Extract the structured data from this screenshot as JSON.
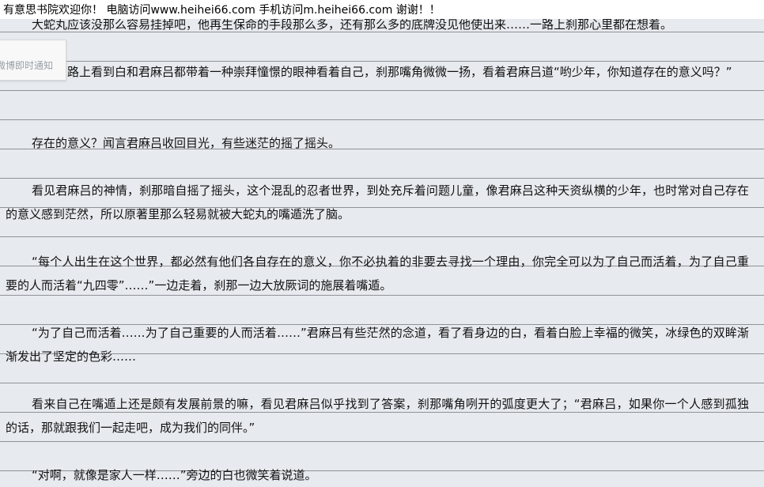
{
  "banner": {
    "text": "有意思书院欢迎你！ 电脑访问www.heihei66.com   手机访问m.heihei66.com  谢谢！！"
  },
  "popup": {
    "text": "微博即时通知"
  },
  "paragraphs": [
    "大蛇丸应该没那么容易挂掉吧，他再生保命的手段那么多，还有那么多的底牌没见他使出来……一路上刹那心里都在想着。",
    "一路的路上看到白和君麻吕都带着一种崇拜憧憬的眼神看着自己，刹那嘴角微微一扬，看着君麻吕道“哟少年，你知道存在的意义吗？”",
    "存在的意义？闻言君麻吕收回目光，有些迷茫的摇了摇头。",
    "看见君麻吕的神情，刹那暗自摇了摇头，这个混乱的忍者世界，到处充斥着问题儿童，像君麻吕这种天资纵横的少年，也时常对自己存在的意义感到茫然，所以原著里那么轻易就被大蛇丸的嘴遁洗了脑。",
    "“每个人出生在这个世界，都必然有他们各自存在的意义，你不必执着的非要去寻找一个理由，你完全可以为了自己而活着，为了自己重要的人而活着“九四零”……”一边走着，刹那一边大放厥词的施展着嘴遁。",
    "“为了自己而活着……为了自己重要的人而活着……”君麻吕有些茫然的念道，看了看身边的白，看着白脸上幸福的微笑，冰绿色的双眸渐渐发出了坚定的色彩……",
    "看来自己在嘴遁上还是颇有发展前景的嘛，看见君麻吕似乎找到了答案，刹那嘴角咧开的弧度更大了；“君麻吕，如果你一个人感到孤独的话，那就跟我们一起走吧，成为我们的同伴。”",
    "“对啊，就像是家人一样……”旁边的白也微笑着说道。"
  ]
}
